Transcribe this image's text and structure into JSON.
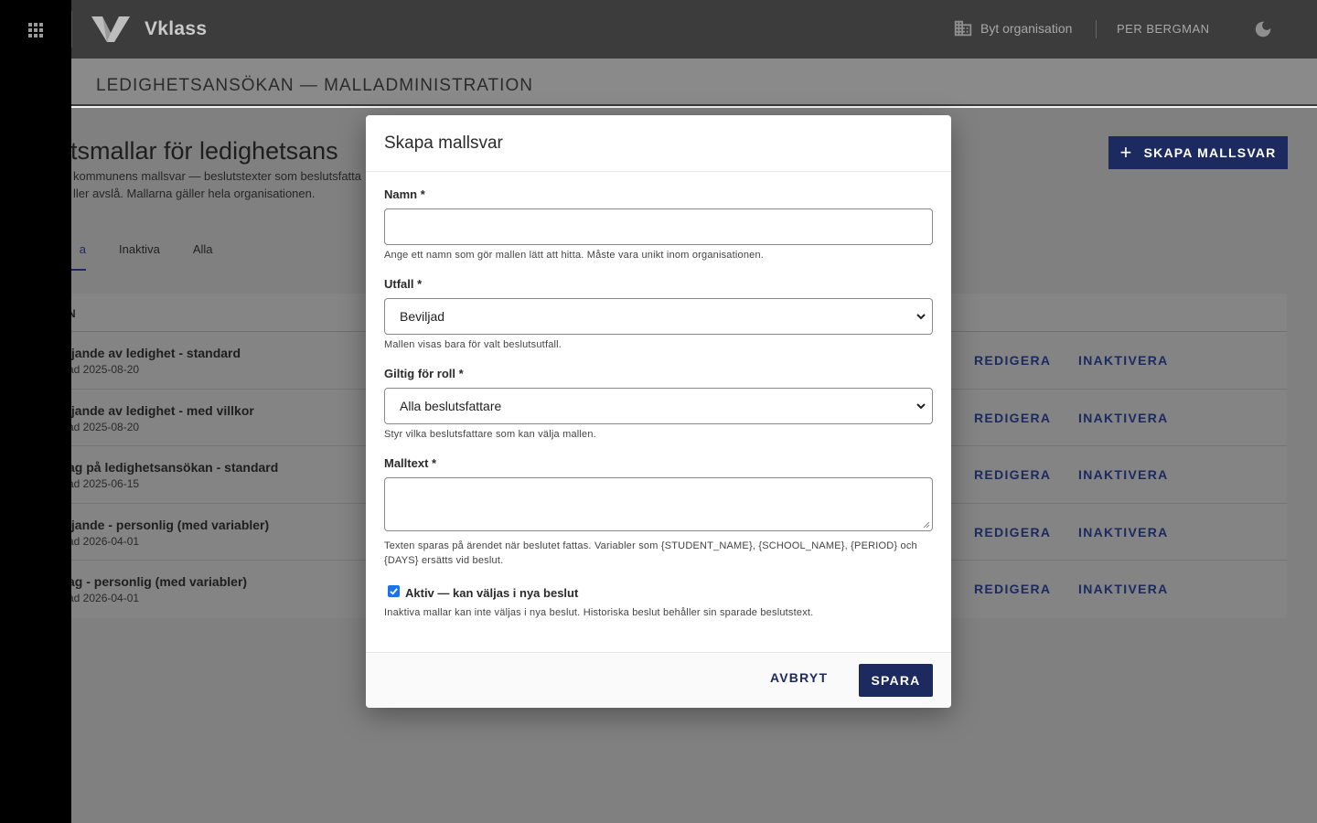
{
  "topbar": {
    "app_name": "Vklass",
    "apps_icon": "apps-grid-icon",
    "org_switch_label": "Byt organisation",
    "org_icon": "building-icon",
    "user_name": "PER BERGMAN",
    "theme_icon": "moon-icon"
  },
  "page": {
    "header_title": "LEDIGHETSANSÖKAN — MALLADMINISTRATION",
    "section_title": "lutsmallar för ledighetsans",
    "section_desc_line1": "kommunens mallsvar — beslutstexter som beslutsfatta",
    "section_desc_line2": "ller avslå. Mallarna gäller hela organisationen.",
    "create_button": "SKAPA MALLSVAR",
    "create_icon": "plus-icon",
    "tabs": [
      {
        "label": "a"
      },
      {
        "label": "Inaktiva"
      },
      {
        "label": "Alla"
      }
    ],
    "table_head_name": "N",
    "rows": [
      {
        "name": "ljande av ledighet - standard",
        "date": "ad 2025-08-20",
        "edit": "REDIGERA",
        "deactivate": "INAKTIVERA"
      },
      {
        "name": "ljande av ledighet - med villkor",
        "date": "ad 2025-08-20",
        "edit": "REDIGERA",
        "deactivate": "INAKTIVERA"
      },
      {
        "name": "ag på ledighetsansökan - standard",
        "date": "ad 2025-06-15",
        "edit": "REDIGERA",
        "deactivate": "INAKTIVERA"
      },
      {
        "name": "ljande - personlig (med variabler)",
        "date": "ad 2026-04-01",
        "edit": "REDIGERA",
        "deactivate": "INAKTIVERA"
      },
      {
        "name": "ag - personlig (med variabler)",
        "date": "ad 2026-04-01",
        "edit": "REDIGERA",
        "deactivate": "INAKTIVERA"
      }
    ]
  },
  "dialog": {
    "title": "Skapa mallsvar",
    "name_label": "Namn *",
    "name_value": "",
    "name_help": "Ange ett namn som gör mallen lätt att hitta. Måste vara unikt inom organisationen.",
    "outcome_label": "Utfall *",
    "outcome_value": "Beviljad",
    "outcome_help": "Mallen visas bara för valt beslutsutfall.",
    "role_label": "Giltig för roll *",
    "role_value": "Alla beslutsfattare",
    "role_help": "Styr vilka beslutsfattare som kan välja mallen.",
    "text_label": "Malltext *",
    "text_value": "",
    "text_help": "Texten sparas på ärendet när beslutet fattas. Variabler som {STUDENT_NAME}, {SCHOOL_NAME}, {PERIOD} och {DAYS} ersätts vid beslut.",
    "active_label": "Aktiv — kan väljas i nya beslut",
    "active_checked": true,
    "active_help": "Inaktiva mallar kan inte väljas i nya beslut. Historiska beslut behåller sin sparade beslutstext.",
    "cancel_button": "AVBRYT",
    "save_button": "SPARA"
  },
  "colors": {
    "primary": "#1c2a60",
    "topbar": "#3c3c3c",
    "checkbox": "#1a73e8"
  }
}
